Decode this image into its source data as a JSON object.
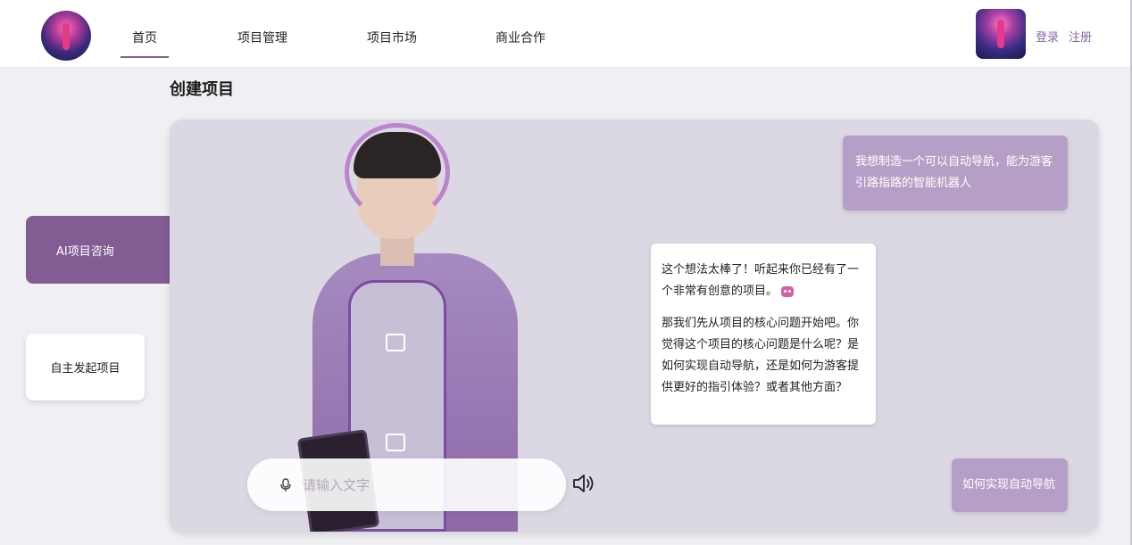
{
  "nav": {
    "items": [
      {
        "label": "首页",
        "active": true
      },
      {
        "label": "项目管理",
        "active": false
      },
      {
        "label": "项目市场",
        "active": false
      },
      {
        "label": "商业合作",
        "active": false
      }
    ],
    "login": "登录",
    "register": "注册"
  },
  "page": {
    "title": "创建项目"
  },
  "side_tabs": {
    "ai_consult": "AI项目咨询",
    "self_start": "自主发起项目"
  },
  "chat": {
    "user_message_1": "我想制造一个可以自动导航，能为游客引路指路的智能机器人",
    "ai_message_p1": "这个想法太棒了！听起来你已经有了一个非常有创意的项目。",
    "ai_message_p2": "那我们先从项目的核心问题开始吧。你觉得这个项目的核心问题是什么呢？是如何实现自动导航，还是如何为游客提供更好的指引体验？或者其他方面？",
    "user_message_2": "如何实现自动导航"
  },
  "input": {
    "placeholder": "请输入文字",
    "value": ""
  },
  "colors": {
    "accent": "#815d94",
    "user_bubble": "#b69fc6",
    "link": "#8a63a8"
  },
  "icons": [
    "mic-icon",
    "speaker-icon"
  ]
}
